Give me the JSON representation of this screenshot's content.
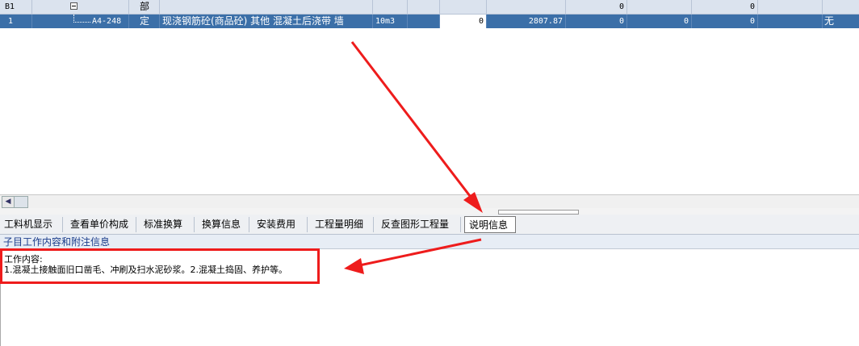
{
  "grid": {
    "row1": {
      "code": "B1",
      "type": "部",
      "val_a": "0",
      "val_b": "0"
    },
    "row2": {
      "index": "1",
      "code": "A4-248",
      "type": "定",
      "name": "现浇钢筋砼(商品砼) 其他 混凝土后浇带 墙",
      "unit": "10m3",
      "qty": "0",
      "price": "2807.87",
      "v1": "0",
      "v2": "0",
      "v3": "0",
      "flag": "无"
    }
  },
  "tabs": [
    {
      "label": "工料机显示"
    },
    {
      "label": "查看单价构成"
    },
    {
      "label": "标准换算"
    },
    {
      "label": "换算信息"
    },
    {
      "label": "安装费用"
    },
    {
      "label": "工程量明细"
    },
    {
      "label": "反查图形工程量"
    },
    {
      "label": "说明信息"
    }
  ],
  "active_tab": "说明信息",
  "panel": {
    "title": "子目工作内容和附注信息",
    "line1": "工作内容:",
    "line2": "1.混凝土接触面旧口凿毛、冲刷及扫水泥砂浆。2.混凝土捣固、养护等。"
  },
  "colors": {
    "selected_row": "#3b6fa8",
    "annotation_red": "#ee1c1c"
  }
}
